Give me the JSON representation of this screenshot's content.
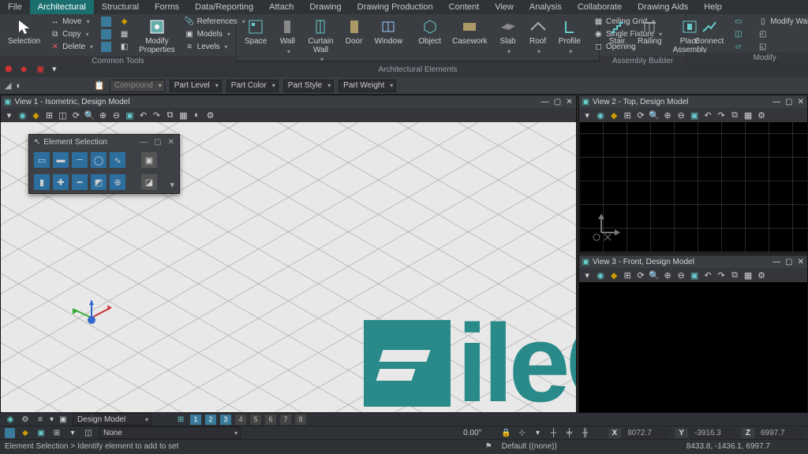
{
  "menu": {
    "tabs": [
      "File",
      "Architectural",
      "Structural",
      "Forms",
      "Data/Reporting",
      "Attach",
      "Drawing",
      "Drawing Production",
      "Content",
      "View",
      "Analysis",
      "Collaborate",
      "Drawing Aids",
      "Help"
    ],
    "active": 1
  },
  "ribbon": {
    "selection": {
      "label": "Selection"
    },
    "common_tools": {
      "title": "Common Tools",
      "move": "Move",
      "copy": "Copy",
      "delete": "Delete",
      "modify_props": "Modify\nProperties",
      "references": "References",
      "models": "Models",
      "levels": "Levels"
    },
    "arch_elements": {
      "title": "Architectural Elements",
      "space": "Space",
      "wall": "Wall",
      "curtain": "Curtain\nWall",
      "door": "Door",
      "window": "Window",
      "object": "Object",
      "casework": "Casework",
      "slab": "Slab",
      "roof": "Roof",
      "profile": "Profile",
      "ceiling": "Ceiling Grid",
      "fixture": "Single Fixture",
      "opening": "Opening"
    },
    "assembly": {
      "title": "Assembly Builder",
      "stair": "Stair",
      "railing": "Railing",
      "place": "Place\nAssembly"
    },
    "modify": {
      "title": "Modify",
      "connect": "Connect",
      "mwall": "Modify Wall"
    }
  },
  "filters": {
    "compound": "Compound",
    "level": "Part Level",
    "color": "Part Color",
    "style": "Part Style",
    "weight": "Part Weight"
  },
  "views": {
    "v1": {
      "title": "View 1 - Isometric, Design Model"
    },
    "v2": {
      "title": "View 2 - Top, Design Model"
    },
    "v3": {
      "title": "View 3 - Front, Design Model"
    }
  },
  "palette": {
    "title": "Element Selection"
  },
  "bottom": {
    "model": "Design Model",
    "numbers": [
      "1",
      "2",
      "3",
      "4",
      "5",
      "6",
      "7",
      "8"
    ],
    "none": "None",
    "angle": "0.00°",
    "x": "8072.7",
    "y": "-3916.3",
    "z": "6997.7",
    "status": "Element Selection > Identify element to add to set",
    "default": "Default ((none))",
    "footer_coords": "8433.8, -1436.1, 6997.7"
  },
  "watermark": "ileCR"
}
